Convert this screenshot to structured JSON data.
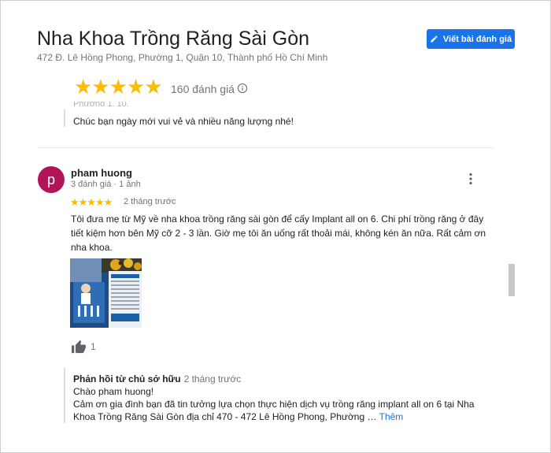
{
  "header": {
    "title": "Nha Khoa Trồng Răng Sài Gòn",
    "address": "472 Đ. Lê Hồng Phong, Phường 1, Quận 10, Thành phố Hồ Chí Minh",
    "write_review_label": "Viết bài đánh giá"
  },
  "rating": {
    "stars": 5,
    "stars_text": "★★★★★",
    "count_label": "160 đánh giá"
  },
  "previous_review": {
    "cut_text": "Phường 1, 10.",
    "text": "Chúc bạn ngày mới vui vẻ và nhiều năng lượng nhé!"
  },
  "review": {
    "avatar_letter": "p",
    "avatar_color": "#b0155a",
    "name": "pham huong",
    "meta": "3 đánh giá · 1 ảnh",
    "stars": 5,
    "stars_text": "★★★★★",
    "time": "2 tháng trước",
    "text": "Tôi đưa mẹ từ Mỹ về nha khoa trồng răng sài gòn để cấy Implant all on 6. Chi phí trồng răng ở đây tiết kiệm hơn bên Mỹ cỡ 2 - 3 lần. Giờ mẹ tôi ăn uống rất thoải mái, không kén ăn nữa. Rất cảm ơn nha khoa.",
    "like_count": "1"
  },
  "owner_reply": {
    "heading": "Phản hồi từ chủ sở hữu",
    "time": "2 tháng trước",
    "greeting": "Chào pham huong!",
    "text": "Cảm ơn gia đình bạn đã tin tưởng lựa chọn thực hiện dịch vụ trồng răng implant all on 6 tại Nha Khoa Trồng Răng Sài Gòn địa chỉ 470 - 472 Lê Hồng Phong, Phường … ",
    "more_label": "Thêm"
  },
  "colors": {
    "accent": "#1a73e8",
    "star": "#fbbc04"
  }
}
